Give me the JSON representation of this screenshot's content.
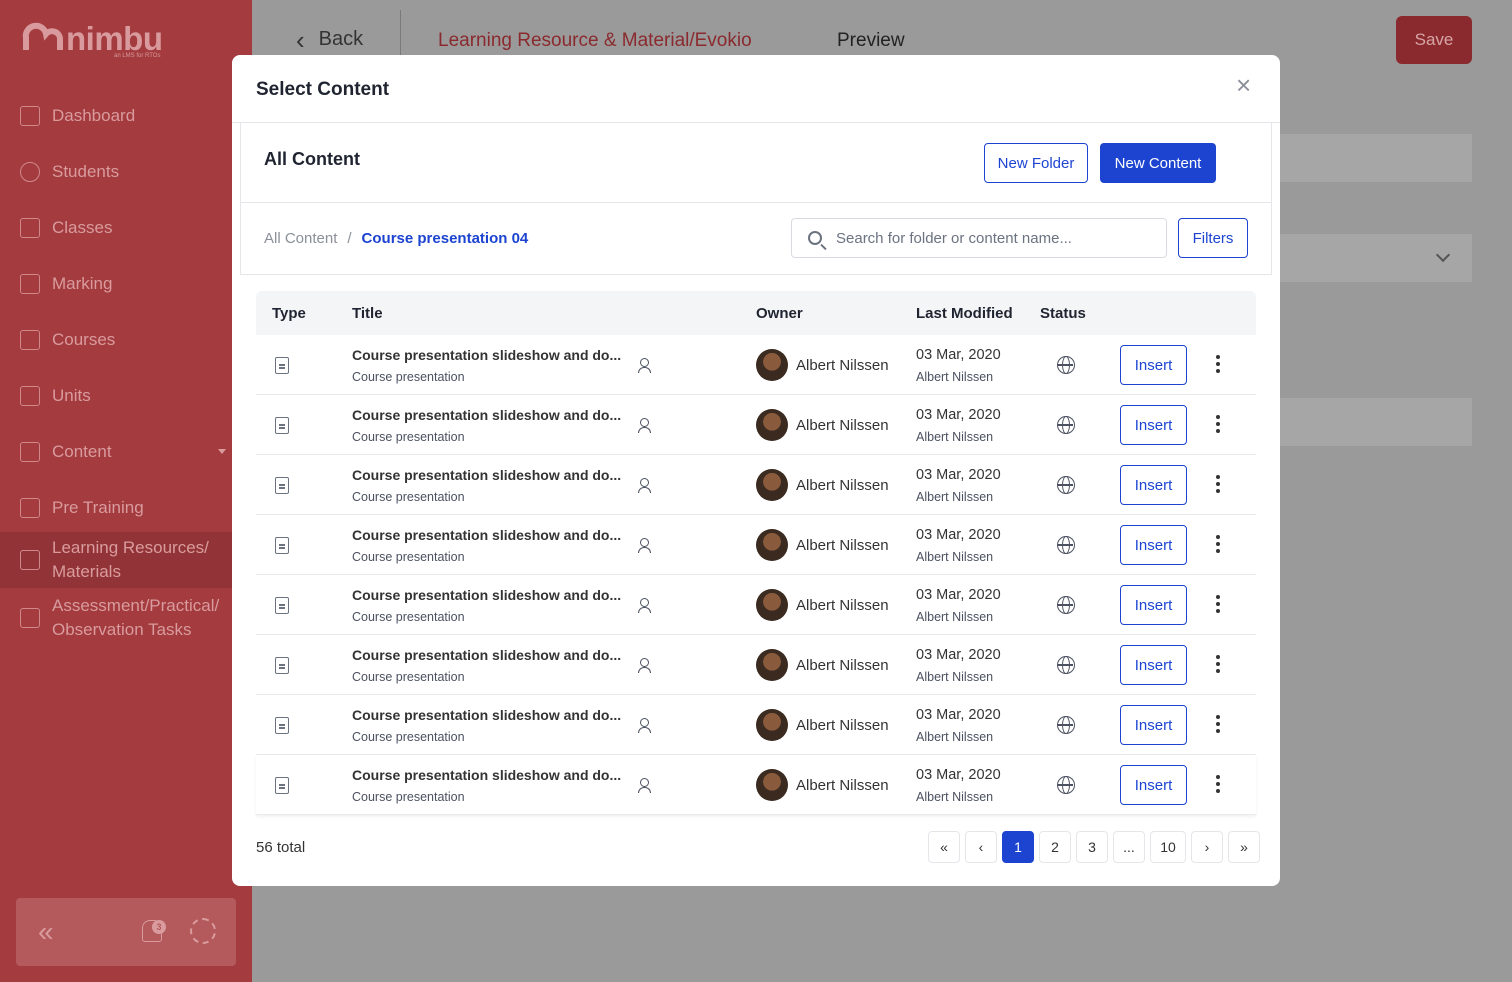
{
  "app": {
    "brand": "nimbu",
    "tagline": "an LMS for RTOs"
  },
  "sidebar": {
    "items": [
      {
        "label": "Dashboard",
        "icon": "grid-icon"
      },
      {
        "label": "Students",
        "icon": "student-icon"
      },
      {
        "label": "Classes",
        "icon": "classes-icon"
      },
      {
        "label": "Marking",
        "icon": "marking-icon"
      },
      {
        "label": "Courses",
        "icon": "courses-icon"
      },
      {
        "label": "Units",
        "icon": "units-icon"
      },
      {
        "label": "Content",
        "icon": "clipboard-icon"
      },
      {
        "label": "Pre Training",
        "icon": "book-icon"
      },
      {
        "label": "Learning Resources/ Materials",
        "icon": "resources-icon"
      },
      {
        "label": "Assessment/Practical/ Observation Tasks",
        "icon": "assessment-icon"
      }
    ],
    "notification_count": "3"
  },
  "header": {
    "back_label": "Back",
    "breadcrumb": "Learning Resource & Material/Evokio",
    "preview_label": "Preview",
    "save_label": "Save"
  },
  "modal": {
    "title": "Select Content",
    "panel_title": "All Content",
    "new_folder_label": "New Folder",
    "new_content_label": "New Content",
    "breadcrumb_root": "All Content",
    "breadcrumb_sep": "/",
    "breadcrumb_current": "Course presentation 04",
    "search_placeholder": "Search for folder or content name...",
    "filters_label": "Filters",
    "columns": {
      "type": "Type",
      "title": "Title",
      "owner": "Owner",
      "last_modified": "Last Modified",
      "status": "Status"
    },
    "rows": [
      {
        "title": "Course presentation slideshow and do...",
        "subtitle": "Course presentation",
        "owner": "Albert Nilssen",
        "date": "03 Mar, 2020",
        "modified_by": "Albert Nilssen",
        "action": "Insert"
      },
      {
        "title": "Course presentation slideshow and do...",
        "subtitle": "Course presentation",
        "owner": "Albert Nilssen",
        "date": "03 Mar, 2020",
        "modified_by": "Albert Nilssen",
        "action": "Insert"
      },
      {
        "title": "Course presentation slideshow and do...",
        "subtitle": "Course presentation",
        "owner": "Albert Nilssen",
        "date": "03 Mar, 2020",
        "modified_by": "Albert Nilssen",
        "action": "Insert"
      },
      {
        "title": "Course presentation slideshow and do...",
        "subtitle": "Course presentation",
        "owner": "Albert Nilssen",
        "date": "03 Mar, 2020",
        "modified_by": "Albert Nilssen",
        "action": "Insert"
      },
      {
        "title": "Course presentation slideshow and do...",
        "subtitle": "Course presentation",
        "owner": "Albert Nilssen",
        "date": "03 Mar, 2020",
        "modified_by": "Albert Nilssen",
        "action": "Insert"
      },
      {
        "title": "Course presentation slideshow and do...",
        "subtitle": "Course presentation",
        "owner": "Albert Nilssen",
        "date": "03 Mar, 2020",
        "modified_by": "Albert Nilssen",
        "action": "Insert"
      },
      {
        "title": "Course presentation slideshow and do...",
        "subtitle": "Course presentation",
        "owner": "Albert Nilssen",
        "date": "03 Mar, 2020",
        "modified_by": "Albert Nilssen",
        "action": "Insert"
      },
      {
        "title": "Course presentation slideshow and do...",
        "subtitle": "Course presentation",
        "owner": "Albert Nilssen",
        "date": "03 Mar, 2020",
        "modified_by": "Albert Nilssen",
        "action": "Insert"
      }
    ],
    "total_label": "56 total",
    "pagination": {
      "first": "«",
      "prev": "‹",
      "pages": [
        "1",
        "2",
        "3",
        "...",
        "10"
      ],
      "current": "1",
      "next": "›",
      "last": "»"
    }
  },
  "colors": {
    "accent": "#1c44d1",
    "sidebar": "#a33b3f",
    "overlay": "#9a9a9a"
  }
}
